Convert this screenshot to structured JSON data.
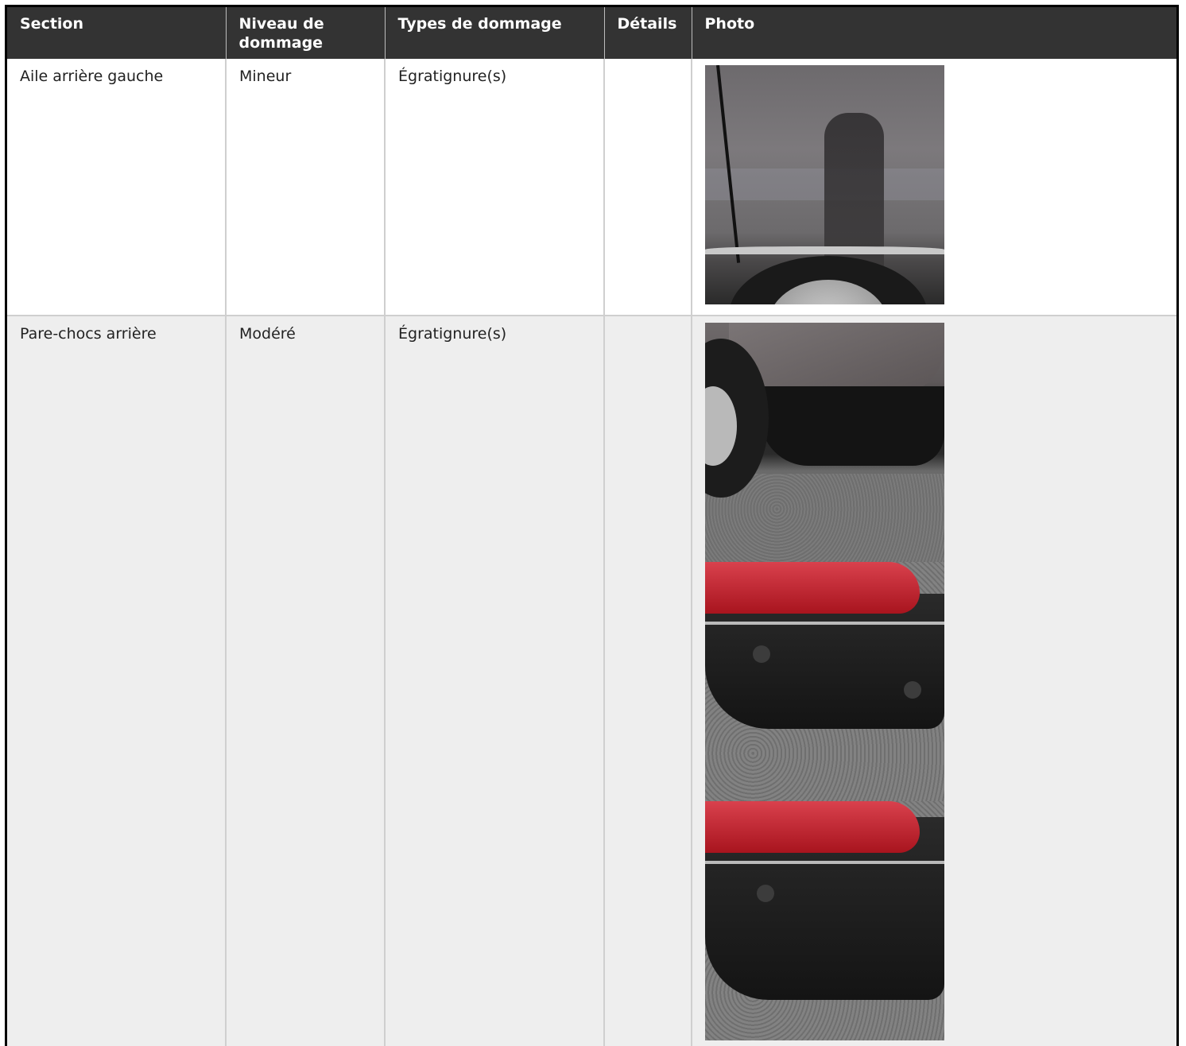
{
  "table": {
    "headers": [
      "Section",
      "Niveau de dommage",
      "Types de dommage",
      "Détails",
      "Photo"
    ],
    "rows": [
      {
        "section": "Aile arrière gauche",
        "niveau": "Mineur",
        "types": "Égratignure(s)",
        "details": "",
        "photos": [
          "car-door-photo"
        ]
      },
      {
        "section": "Pare-chocs arrière",
        "niveau": "Modéré",
        "types": "Égratignure(s)",
        "details": "",
        "photos": [
          "bumper-photo-1",
          "bumper-photo-2",
          "bumper-photo-3"
        ]
      }
    ]
  }
}
